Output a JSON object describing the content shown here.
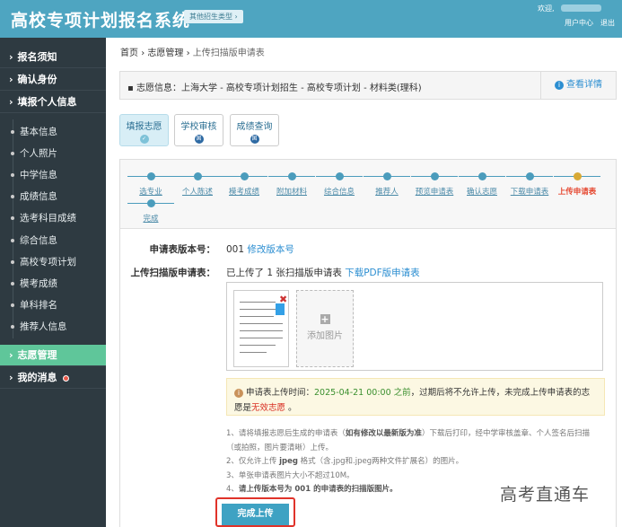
{
  "header": {
    "title": "高校专项计划报名系统",
    "other_types": "其他招生类型 ›",
    "welcome": "欢迎,",
    "user_center": "用户中心",
    "logout": "退出"
  },
  "sidebar": {
    "top": [
      {
        "label": "报名须知"
      },
      {
        "label": "确认身份"
      },
      {
        "label": "填报个人信息"
      }
    ],
    "sub": [
      "基本信息",
      "个人照片",
      "中学信息",
      "成绩信息",
      "选考科目成绩",
      "综合信息",
      "高校专项计划",
      "模考成绩",
      "单科排名",
      "推荐人信息"
    ],
    "manage": "志愿管理",
    "messages": "我的消息"
  },
  "breadcrumb": {
    "home": "首页",
    "sep": "›",
    "section": "志愿管理",
    "current": "上传扫描版申请表"
  },
  "info": {
    "text": "志愿信息：上海大学 - 高校专项计划招生 - 高校专项计划 - 材料类(理科)",
    "detail": "查看详情"
  },
  "tabs": [
    {
      "label": "填报志愿",
      "icon": "✓"
    },
    {
      "label": "学校审核",
      "icon": "囯"
    },
    {
      "label": "成绩查询",
      "icon": "囯"
    }
  ],
  "steps": [
    "选专业",
    "个人陈述",
    "模考成绩",
    "附加材料",
    "综合信息",
    "推荐人",
    "预览申请表",
    "确认志愿",
    "下载申请表",
    "上传申请表",
    "完成"
  ],
  "current_step": 9,
  "form": {
    "version_label": "申请表版本号：",
    "version": "001",
    "edit_version": "修改版本号",
    "upload_label": "上传扫描版申请表：",
    "uploaded_text": "已上传了 1 张扫描版申请表",
    "download_pdf": "下载PDF版申请表",
    "add_image": "添加图片"
  },
  "notice": {
    "prefix": "申请表上传时间：",
    "deadline": "2025-04-21 00:00 之前",
    "middle": "，过期后将不允许上传，未完成上传申请表的志愿是",
    "invalid": "无效志愿",
    "end": " 。"
  },
  "instructions": {
    "i1a": "1、请将填报志愿后生成的申请表（",
    "i1b": "如有修改以最新版为准",
    "i1c": "）下载后打印，经中学审核盖章、个人签名后扫描（或拍照，图片要清晰）上传。",
    "i2a": "2、仅允许上传 ",
    "i2b": "jpeg",
    "i2c": " 格式（含.jpg和.jpeg两种文件扩展名）的图片。",
    "i3": "3、单张申请表图片大小不超过10M。",
    "i4a": "4、",
    "i4b": "请上传版本号为 ",
    "i4c": "001",
    "i4d": " 的申请表的扫描版图片。"
  },
  "submit": "完成上传",
  "watermark": "高考直通车"
}
